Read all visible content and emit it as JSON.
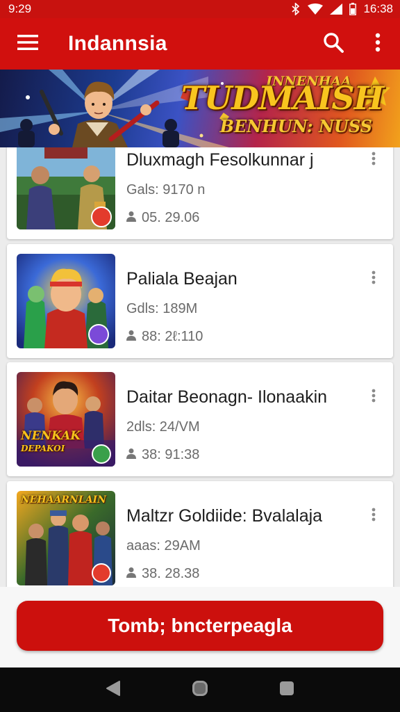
{
  "status_bar": {
    "time": "9:29",
    "clock_right": "16:38"
  },
  "app_bar": {
    "title": "Indannsia"
  },
  "banner": {
    "headline_top": "INNENHAA",
    "headline": "TUDMAISH",
    "subline": "BENHUN: NUSS"
  },
  "items": [
    {
      "name": "Dluxmagh Fesolkunnar j",
      "meta": "Gals: 9170 n",
      "count": "05. 29.06",
      "badge": "✕"
    },
    {
      "name": "Paliala Beajan",
      "meta": "Gdls: 189M",
      "count": "88: 2ℓ:110",
      "badge": "≋"
    },
    {
      "name": "Daitar Beonagn- Ilonaakin",
      "meta": "2dls: 24/VM",
      "count": "38: 91:38",
      "badge": "⌖",
      "thumb_text": "NENKAK\nDEPAKOI"
    },
    {
      "name": "Maltzr Goldiide: Bvalalaja",
      "meta": "aaas: 29AM",
      "count": "38. 28.38",
      "badge": "✕",
      "thumb_text": "NEHAARNLAIN"
    }
  ],
  "cta": {
    "label": "Tomb; bncterpeagla"
  },
  "colors": {
    "primary": "#d1100e",
    "status": "#c8120f",
    "nav": "#0b0b0b"
  }
}
